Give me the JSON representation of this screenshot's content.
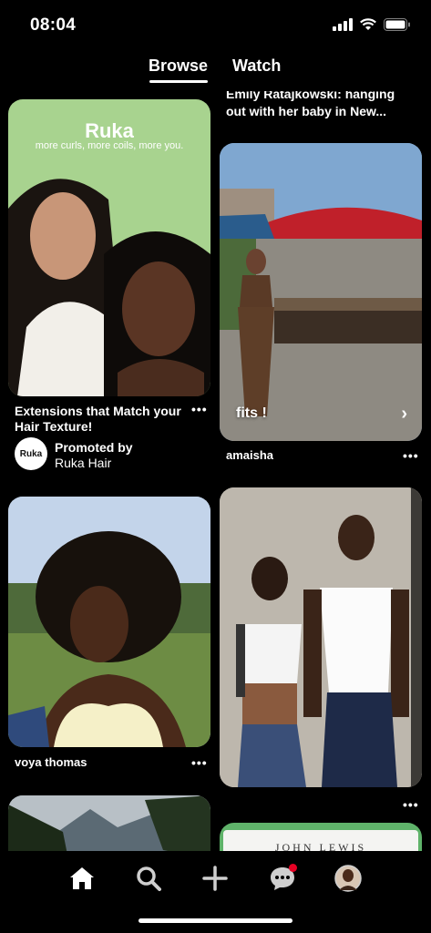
{
  "status_bar": {
    "time": "08:04"
  },
  "tabs": {
    "browse": "Browse",
    "watch": "Watch"
  },
  "pins": {
    "ruka": {
      "brand": "Ruka",
      "tagline": "more curls, more coils, more you.",
      "title_line1": "Extensions that Match your",
      "title_line2": "Hair Texture!",
      "avatar_text": "Ruka",
      "promoted_by": "Promoted by",
      "advertiser": "Ruka Hair"
    },
    "top_partial": {
      "title_line1": "Emily Ratajkowski: hanging",
      "title_line2": "out with her baby in New..."
    },
    "fits": {
      "overlay_text": "fits !",
      "author": "amaisha"
    },
    "voya": {
      "author": "voya thomas"
    },
    "couple": {},
    "john_lewis": {
      "brand": "JOHN LEWIS"
    }
  },
  "colors": {
    "accent": "#e60023",
    "ruka_bg": "#a8d38f",
    "ruka_strip": "#5fb36a"
  },
  "icons": [
    "home-icon",
    "search-icon",
    "plus-icon",
    "chat-icon",
    "profile-avatar"
  ]
}
